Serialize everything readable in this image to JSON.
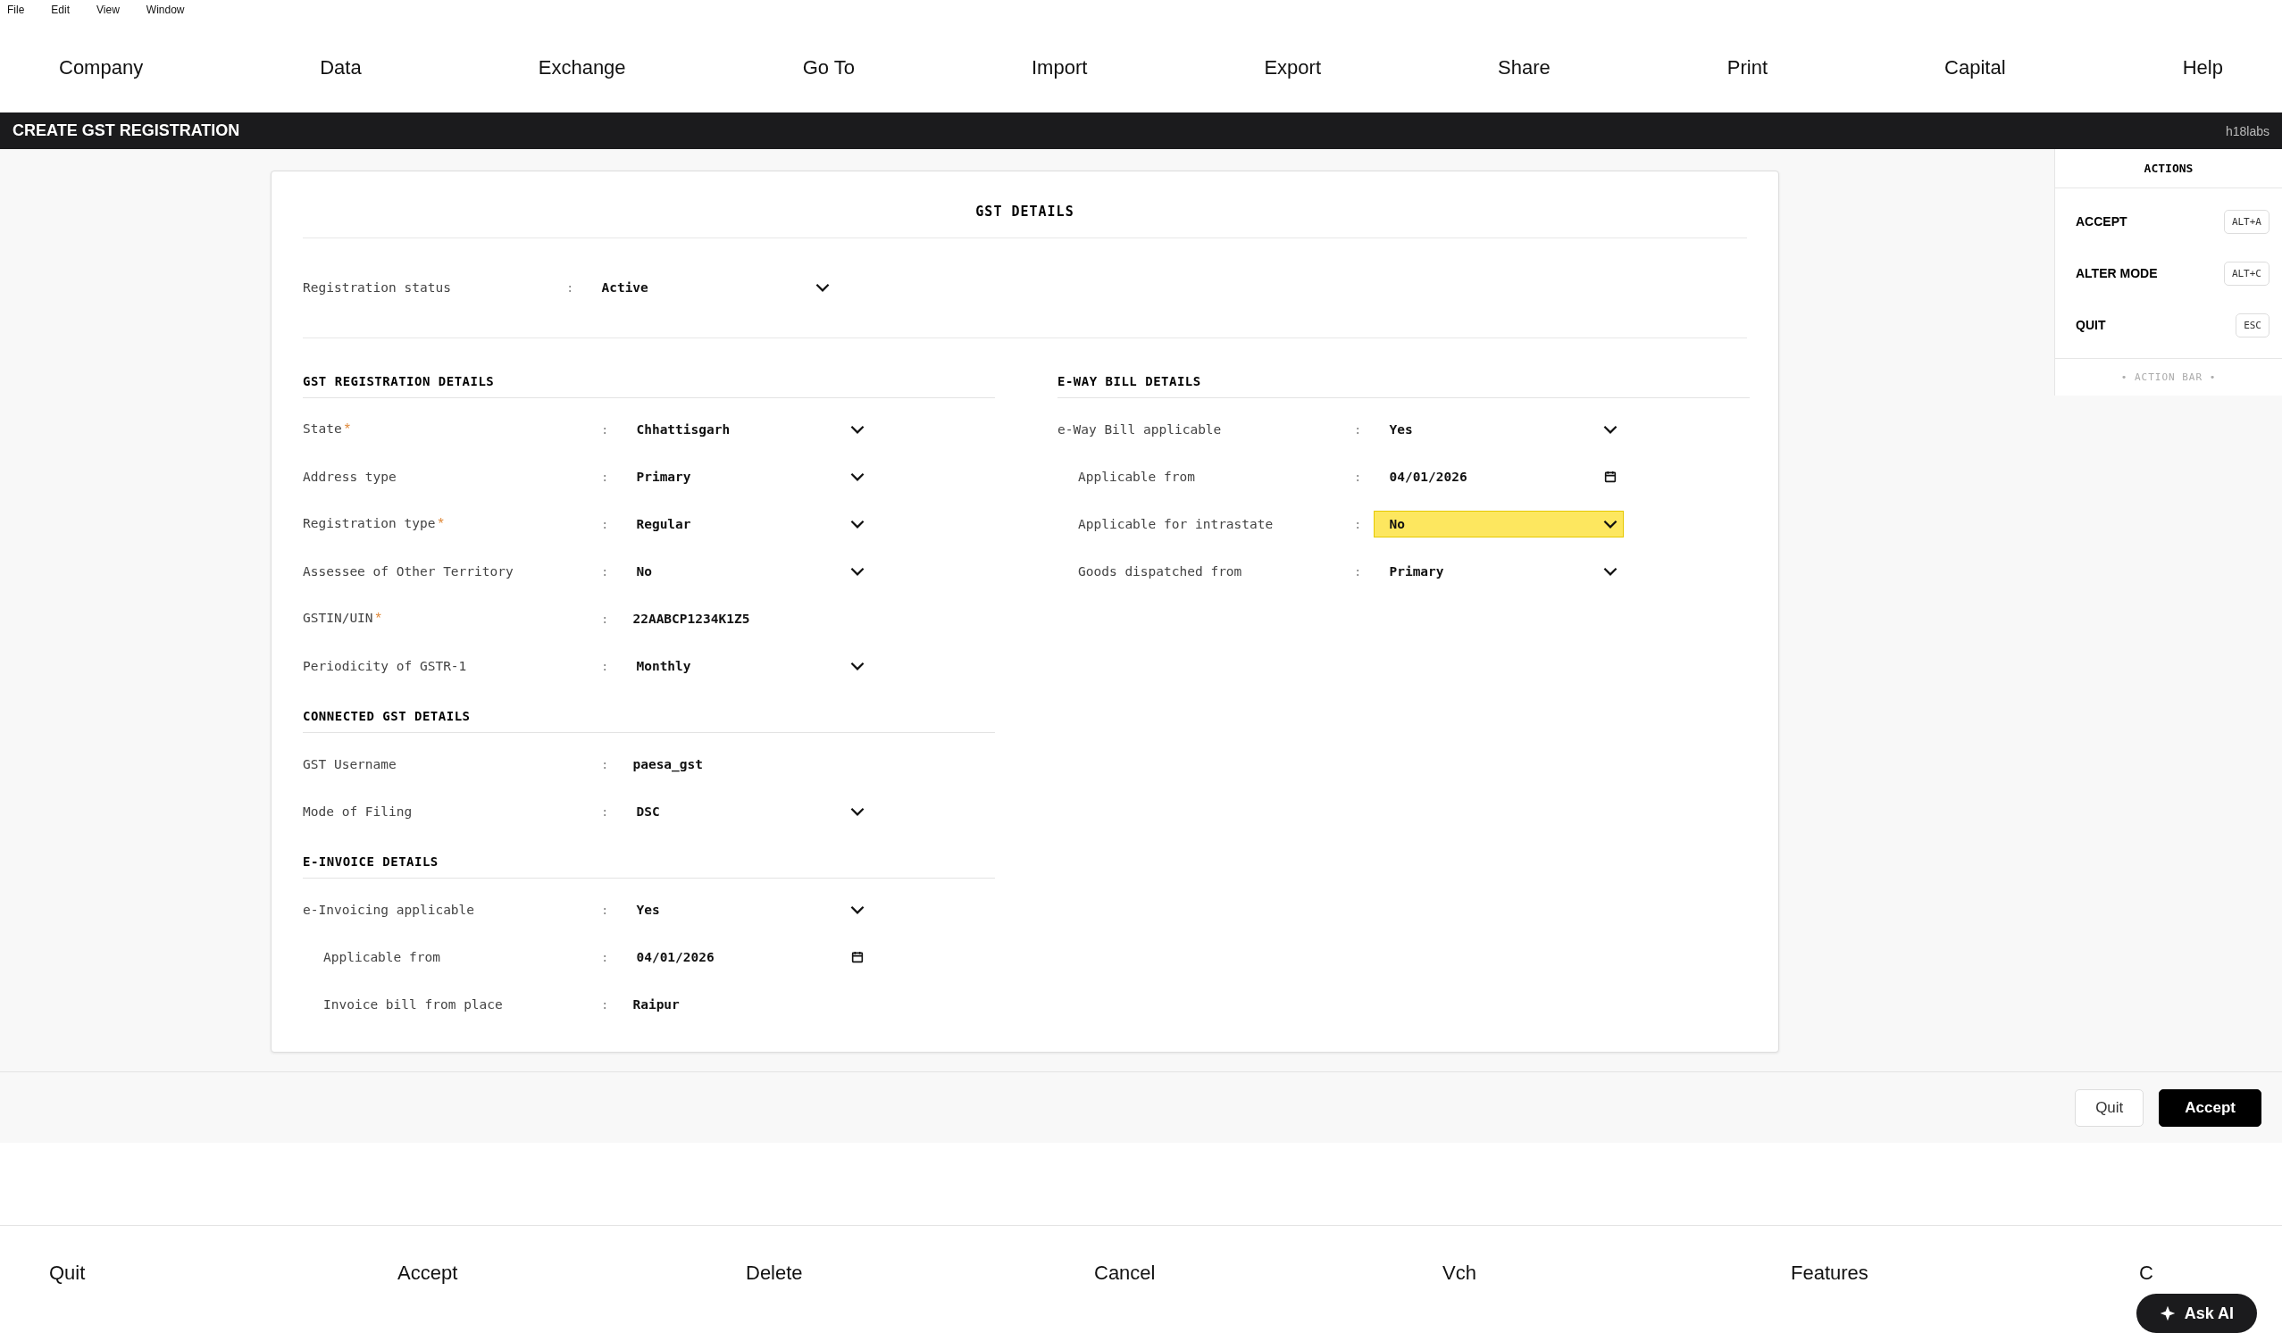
{
  "menu_bar": [
    "File",
    "Edit",
    "View",
    "Window"
  ],
  "top_nav": [
    "Company",
    "Data",
    "Exchange",
    "Go To",
    "Import",
    "Export",
    "Share",
    "Print",
    "Capital",
    "Help"
  ],
  "title_bar": {
    "title": "CREATE GST REGISTRATION",
    "brand": "h18labs"
  },
  "form": {
    "title": "GST DETAILS",
    "status": {
      "label": "Registration status",
      "colon": ":",
      "value": "Active",
      "kind": "select",
      "focused": false
    },
    "left_sections": [
      {
        "title": "GST REGISTRATION DETAILS",
        "fields": [
          {
            "label": "State",
            "required_mark": "*",
            "colon": ":",
            "value": "Chhattisgarh",
            "kind": "select",
            "focused": false
          },
          {
            "label": "Address type",
            "colon": ":",
            "value": "Primary",
            "kind": "select",
            "focused": false
          },
          {
            "label": "Registration type",
            "required_mark": "*",
            "colon": ":",
            "value": "Regular",
            "kind": "select",
            "focused": false
          },
          {
            "label": "Assessee of Other Territory",
            "colon": ":",
            "value": "No",
            "kind": "select",
            "focused": false
          },
          {
            "label": "GSTIN/UIN",
            "required_mark": "*",
            "colon": ":",
            "value": "22AABCP1234K1Z5",
            "kind": "text",
            "focused": false
          },
          {
            "label": "Periodicity of GSTR-1",
            "colon": ":",
            "value": "Monthly",
            "kind": "select",
            "focused": false
          }
        ]
      },
      {
        "title": "CONNECTED GST DETAILS",
        "fields": [
          {
            "label": "GST Username",
            "colon": ":",
            "value": "paesa_gst",
            "kind": "text",
            "focused": false
          },
          {
            "label": "Mode of Filing",
            "colon": ":",
            "value": "DSC",
            "kind": "select",
            "focused": false
          }
        ]
      },
      {
        "title": "E-INVOICE DETAILS",
        "fields": [
          {
            "label": "e-Invoicing applicable",
            "colon": ":",
            "value": "Yes",
            "kind": "select",
            "focused": false,
            "children": [
              {
                "label": "Applicable from",
                "colon": ":",
                "value": "04/01/2026",
                "kind": "date",
                "focused": false
              },
              {
                "label": "Invoice bill from place",
                "colon": ":",
                "value": "Raipur",
                "kind": "text",
                "focused": false
              }
            ]
          }
        ]
      }
    ],
    "right_sections": [
      {
        "title": "E-WAY BILL DETAILS",
        "fields": [
          {
            "label": "e-Way Bill applicable",
            "colon": ":",
            "value": "Yes",
            "kind": "select",
            "focused": false,
            "children": [
              {
                "label": "Applicable from",
                "colon": ":",
                "value": "04/01/2026",
                "kind": "date",
                "focused": false
              },
              {
                "label": "Applicable for intrastate",
                "colon": ":",
                "value": "No",
                "kind": "select",
                "focused": true
              },
              {
                "label": "Goods dispatched from",
                "colon": ":",
                "value": "Primary",
                "kind": "select",
                "focused": false
              }
            ]
          }
        ]
      }
    ]
  },
  "actions_panel": {
    "title": "ACTIONS",
    "items": [
      {
        "label": "ACCEPT",
        "shortcut": "ALT+A"
      },
      {
        "label": "ALTER MODE",
        "shortcut": "ALT+C"
      },
      {
        "label": "QUIT",
        "shortcut": "ESC"
      }
    ],
    "footer": "• ACTION BAR •"
  },
  "footer_buttons": [
    {
      "label": "Quit",
      "kind": "secondary"
    },
    {
      "label": "Accept",
      "kind": "primary"
    }
  ],
  "bottom_nav": [
    "Quit",
    "Accept",
    "Delete",
    "Cancel",
    "Vch",
    "Features",
    "C"
  ],
  "ask_ai": {
    "label": "Ask AI"
  }
}
